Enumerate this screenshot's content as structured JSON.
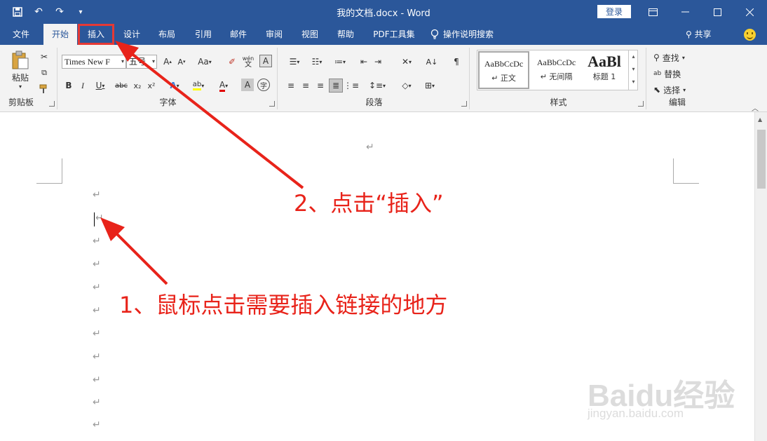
{
  "title_bar": {
    "title": "我的文档.docx  -  Word",
    "login_label": "登录",
    "window_buttons": [
      "ribbon-display-icon",
      "minimize-icon",
      "maximize-icon",
      "close-icon"
    ]
  },
  "tabs": [
    {
      "label": "文件"
    },
    {
      "label": "开始"
    },
    {
      "label": "插入"
    },
    {
      "label": "设计"
    },
    {
      "label": "布局"
    },
    {
      "label": "引用"
    },
    {
      "label": "邮件"
    },
    {
      "label": "审阅"
    },
    {
      "label": "视图"
    },
    {
      "label": "帮助"
    },
    {
      "label": "PDF工具集"
    },
    {
      "label": "操作说明搜索"
    }
  ],
  "share_label": "共享",
  "ribbon": {
    "clipboard": {
      "paste_label": "粘贴",
      "group_label": "剪贴板"
    },
    "font": {
      "font_name": "Times New F",
      "font_size": "五号",
      "aa_label": "Aa",
      "group_label": "字体",
      "wen_label": "wén",
      "wen_char": "文",
      "enclose_char": "字"
    },
    "paragraph": {
      "group_label": "段落"
    },
    "styles": {
      "group_label": "样式",
      "items": [
        {
          "preview": "AaBbCcDc",
          "name": "↵ 正文"
        },
        {
          "preview": "AaBbCcDc",
          "name": "↵ 无间隔"
        },
        {
          "preview": "AaBl",
          "name": "标题 1"
        }
      ]
    },
    "editing": {
      "group_label": "编辑",
      "find_label": "查找",
      "replace_label": "替换",
      "select_label": "选择"
    }
  },
  "document": {
    "paragraph_mark": "↵"
  },
  "annotations": {
    "step1": "1、鼠标点击需要插入链接的地方",
    "step2": "2、点击“插入”"
  },
  "watermark": {
    "brand": "Baidu经验",
    "url": "jingyan.baidu.com"
  },
  "colors": {
    "word_blue": "#2b579a",
    "annotation_red": "#e8231a"
  }
}
